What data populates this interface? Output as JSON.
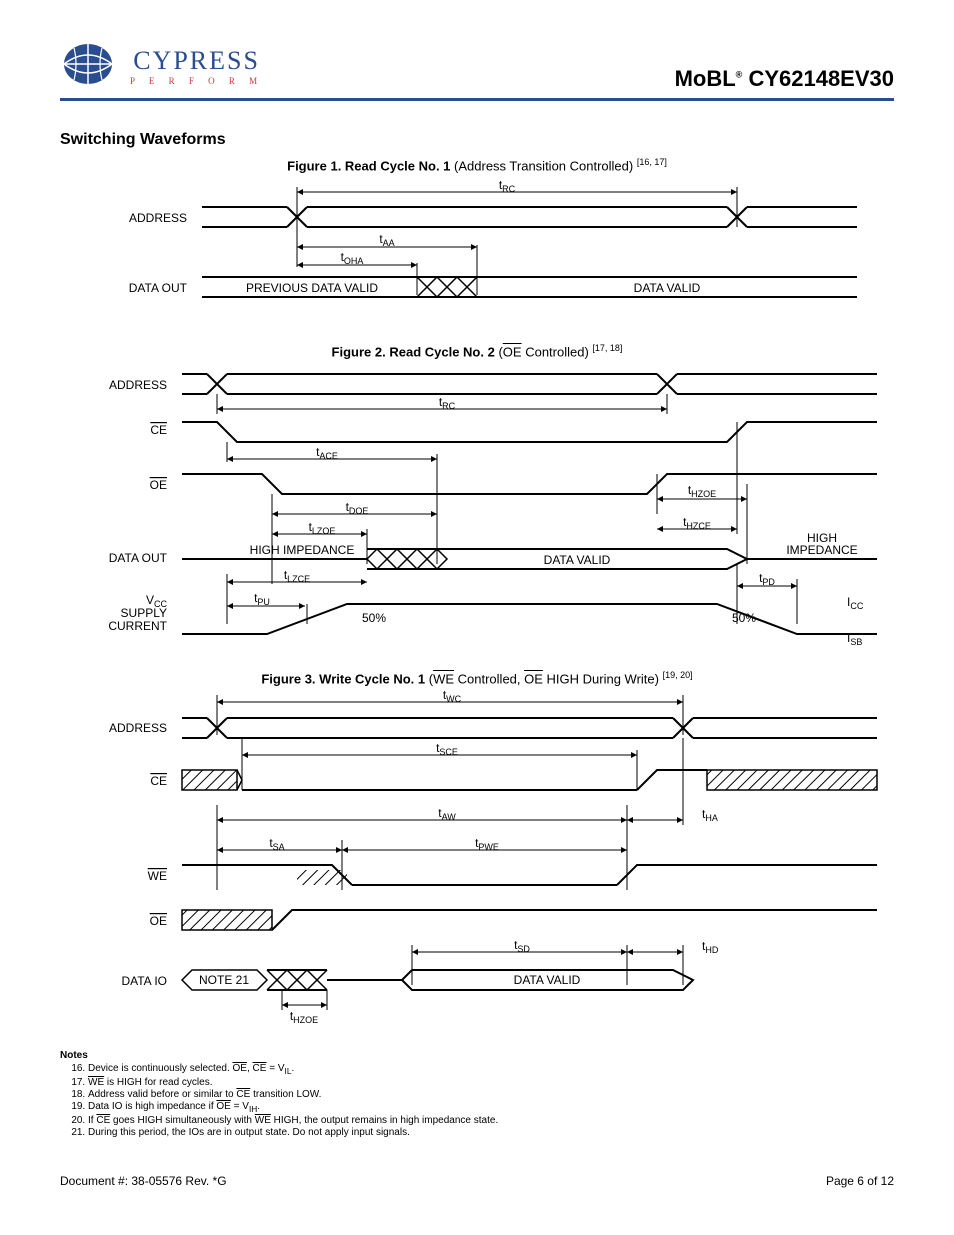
{
  "header": {
    "logo_name": "CYPRESS",
    "logo_tag": "P E R F O R M",
    "part_prefix": "MoBL",
    "part_number": "CY62148EV30"
  },
  "section_title": "Switching Waveforms",
  "figures": {
    "f1": {
      "prefix": "Figure 1.  ",
      "bold": "Read Cycle No. 1",
      "rest": " (Address Transition Controlled) ",
      "refs": "[16, 17]",
      "signals": {
        "addr": "ADDRESS",
        "dout": "DATA OUT",
        "prev": "PREVIOUS DATA VALID",
        "valid": "DATA VALID",
        "trc": "t",
        "trc_sub": "RC",
        "taa": "t",
        "taa_sub": "AA",
        "toha": "t",
        "toha_sub": "OHA"
      }
    },
    "f2": {
      "prefix": "Figure 2.  ",
      "bold": "Read Cycle No. 2",
      "rest_a": " (",
      "oe": "OE",
      "rest_b": " Controlled) ",
      "refs": "[17, 18]",
      "signals": {
        "addr": "ADDRESS",
        "ce": "CE",
        "oe": "OE",
        "dout": "DATA  OUT",
        "vcc1": "V",
        "vcc1_sub": "CC",
        "vcc2": "SUPPLY",
        "vcc3": "CURRENT",
        "trc": "t",
        "trc_sub": "RC",
        "tace": "t",
        "tace_sub": "ACE",
        "tdoe": "t",
        "tdoe_sub": "DOE",
        "tlzoe": "t",
        "tlzoe_sub": "LZOE",
        "tlzce": "t",
        "tlzce_sub": "LZCE",
        "thzoe": "t",
        "thzoe_sub": "HZOE",
        "thzce": "t",
        "thzce_sub": "HZCE",
        "tpu": "t",
        "tpu_sub": "PU",
        "tpd": "t",
        "tpd_sub": "PD",
        "hi1": "HIGH IMPEDANCE",
        "hi2a": "HIGH",
        "hi2b": "IMPEDANCE",
        "valid": "DATA VALID",
        "p50a": "50%",
        "p50b": "50%",
        "icc": "I",
        "icc_sub": "CC",
        "isb": "I",
        "isb_sub": "SB"
      }
    },
    "f3": {
      "prefix": "Figure 3.  ",
      "bold": "Write Cycle No. 1",
      "rest_a": " (",
      "we": "WE",
      "rest_b": " Controlled, ",
      "oe": "OE",
      "rest_c": " HIGH During Write) ",
      "refs": "[19, 20]",
      "signals": {
        "addr": "ADDRESS",
        "ce": "CE",
        "we": "WE",
        "oe": "OE",
        "dio": "DATA  IO",
        "twc": "t",
        "twc_sub": "WC",
        "tsce": "t",
        "tsce_sub": "SCE",
        "taw": "t",
        "taw_sub": "AW",
        "tha": "t",
        "tha_sub": "HA",
        "tsa": "t",
        "tsa_sub": "SA",
        "tpwe": "t",
        "tpwe_sub": "PWE",
        "tsd": "t",
        "tsd_sub": "SD",
        "thd": "t",
        "thd_sub": "HD",
        "thzoe": "t",
        "thzoe_sub": "HZOE",
        "note21": "NOTE 21",
        "valid": "DATA VALID"
      }
    }
  },
  "notes": {
    "heading": "Notes",
    "items": [
      {
        "n": "16",
        "html": "Device is continuously selected. <span class=\"ov\">OE</span>, <span class=\"ov\">CE</span> = V<sub>IL</sub>."
      },
      {
        "n": "17",
        "html": "<span class=\"ov\">WE</span> is HIGH for read cycles."
      },
      {
        "n": "18",
        "html": "Address valid before or similar to <span class=\"ov\">CE</span> transition LOW."
      },
      {
        "n": "19",
        "html": "Data IO is high impedance if <span class=\"ov\">OE</span> = V<sub>IH</sub>."
      },
      {
        "n": "20",
        "html": "If <span class=\"ov\">CE</span> goes HIGH simultaneously with <span class=\"ov\">WE</span> HIGH, the output remains in high impedance state."
      },
      {
        "n": "21",
        "html": "During this period, the IOs are in output state. Do not apply input signals."
      }
    ]
  },
  "footer": {
    "doc": "Document #: 38-05576 Rev. *G",
    "page": "Page 6 of 12"
  }
}
